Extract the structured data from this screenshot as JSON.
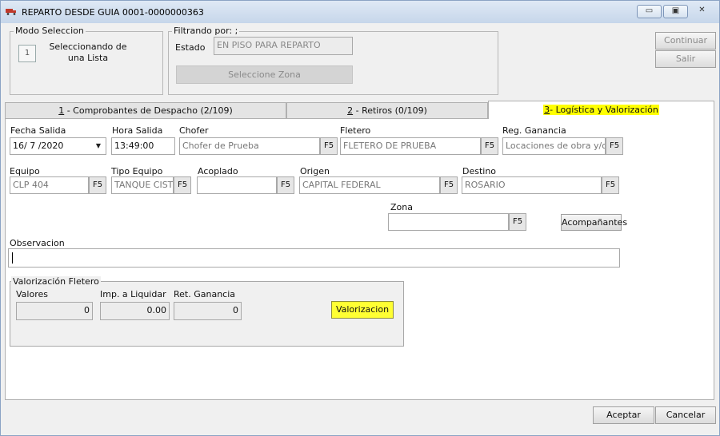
{
  "window": {
    "title": "REPARTO DESDE GUIA 0001-0000000363",
    "icon": "truck-icon",
    "controls": {
      "minimize": "▭",
      "maximize": "▣",
      "close": "✕"
    }
  },
  "modo_seleccion": {
    "legend": "Modo Seleccion",
    "number": "1",
    "text": "Seleccionando de una Lista"
  },
  "filtrando": {
    "legend": "Filtrando por: ;",
    "estado_label": "Estado",
    "estado_value": "EN PISO PARA REPARTO",
    "zona_button": "Seleccione Zona"
  },
  "side_buttons": {
    "continuar": "Continuar",
    "salir": "Salir"
  },
  "tabs": [
    {
      "key": "1",
      "label": " - Comprobantes de Despacho (2/109)"
    },
    {
      "key": "2",
      "label": " - Retiros (0/109)"
    },
    {
      "key": "3",
      "label": "- Logística y Valorización"
    }
  ],
  "form": {
    "fecha_salida": {
      "label": "Fecha Salida",
      "value": "16/ 7 /2020"
    },
    "hora_salida": {
      "label": "Hora Salida",
      "value": "13:49:00"
    },
    "chofer": {
      "label": "Chofer",
      "value": "Chofer de Prueba"
    },
    "fletero": {
      "label": "Fletero",
      "value": "FLETERO DE PRUEBA"
    },
    "reg_ganancia": {
      "label": "Reg. Ganancia",
      "value": "Locaciones de obra y/o s"
    },
    "equipo": {
      "label": "Equipo",
      "value": "CLP 404"
    },
    "tipo_equipo": {
      "label": "Tipo Equipo",
      "value": "TANQUE CISTI"
    },
    "acoplado": {
      "label": "Acoplado",
      "value": ""
    },
    "origen": {
      "label": "Origen",
      "value": "CAPITAL FEDERAL"
    },
    "destino": {
      "label": "Destino",
      "value": "ROSARIO"
    },
    "zona": {
      "label": "Zona",
      "value": ""
    },
    "acompanantes_button": "Acompañantes",
    "observacion": {
      "label": "Observacion",
      "value": ""
    },
    "f5": "F5"
  },
  "valorizacion": {
    "legend": "Valorización Fletero",
    "valores": {
      "label": "Valores",
      "value": "0"
    },
    "imp_liquidar": {
      "label": "Imp. a Liquidar",
      "value": "0.00"
    },
    "ret_ganancia": {
      "label": "Ret. Ganancia",
      "value": "0"
    },
    "button": "Valorizacion"
  },
  "footer": {
    "aceptar": "Aceptar",
    "cancelar": "Cancelar"
  }
}
